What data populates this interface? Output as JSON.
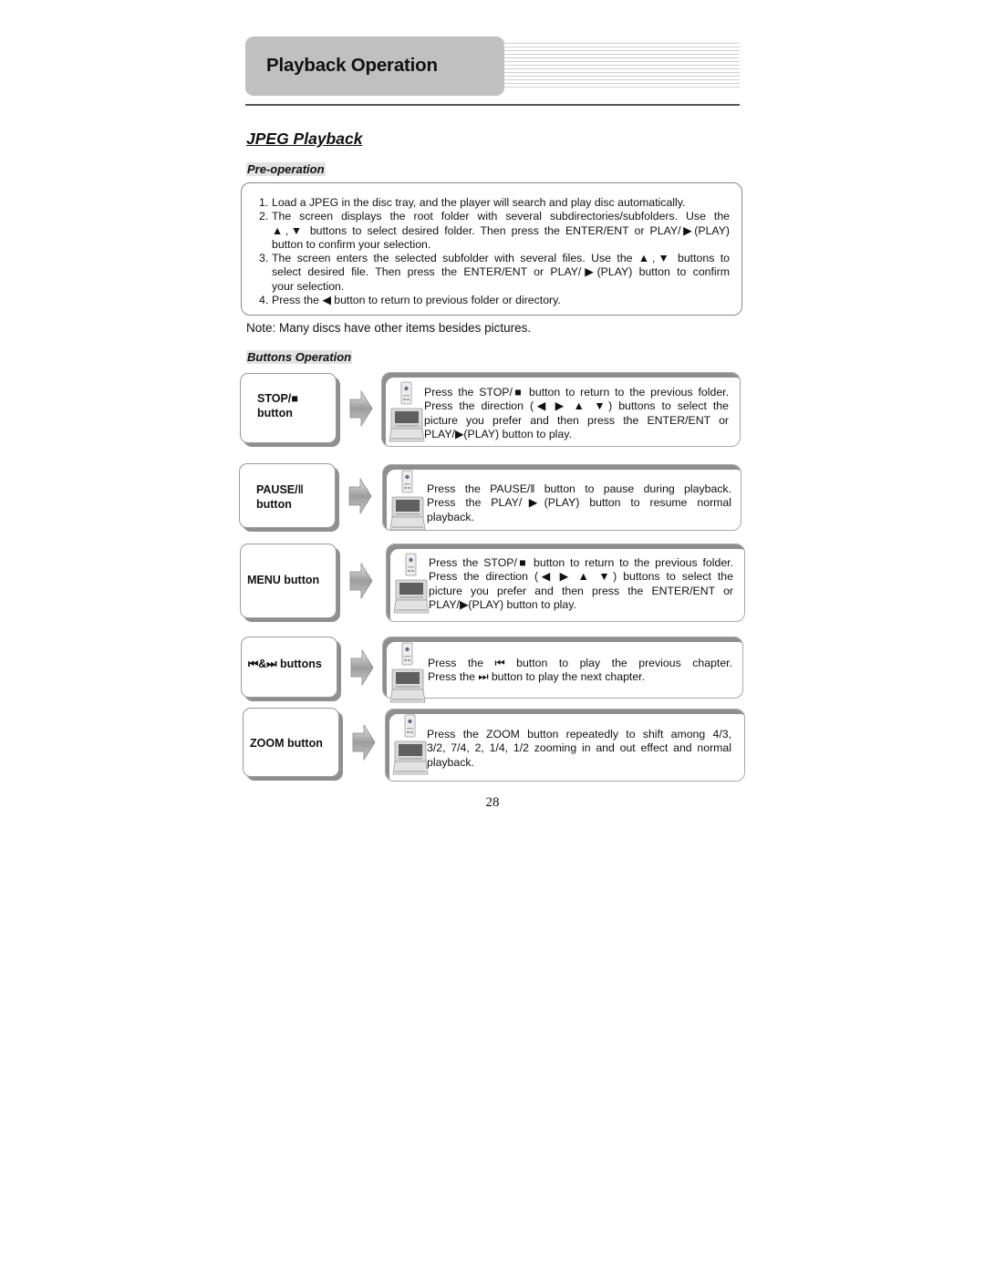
{
  "header": {
    "title": "Playback Operation"
  },
  "section": {
    "title": "JPEG Playback"
  },
  "pre_operation": {
    "title": "Pre-operation",
    "items": [
      {
        "num": "1.",
        "lines": [
          "Load a JPEG in the disc tray, and the player will search and play disc automatically."
        ]
      },
      {
        "num": "2.",
        "lines": [
          "The screen displays the root folder with several subdirectories/subfolders. Use the",
          "▲,▼ buttons to select desired folder. Then press the ENTER/ENT or PLAY/▶(PLAY)",
          "button to confirm your selection."
        ]
      },
      {
        "num": "3.",
        "lines": [
          "The screen enters the selected subfolder with several files. Use the ▲,▼ buttons to",
          "select desired file. Then press the ENTER/ENT or PLAY/▶(PLAY) button to confirm",
          "your selection."
        ]
      },
      {
        "num": "4.",
        "lines": [
          "Press the ◀ button to return to previous folder or directory."
        ]
      }
    ]
  },
  "note": "Note: Many discs have other items besides pictures.",
  "buttons_operation": {
    "title": "Buttons Operation",
    "rows": [
      {
        "label_line1": "STOP/■",
        "label_line2": "button",
        "icon": "device-remote-icon",
        "lines": [
          "Press the STOP/■ button to return to the previous folder.",
          "Press the direction (◀ ▶ ▲ ▼) buttons to select the",
          "picture you prefer and then press the ENTER/ENT or",
          "PLAY/▶(PLAY) button to play."
        ]
      },
      {
        "label_line1": "PAUSE/‖",
        "label_line2": "button",
        "icon": "device-remote-icon",
        "lines": [
          "Press the PAUSE/‖ button to pause during playback.",
          "Press the PLAY/▶(PLAY) button to resume normal",
          "playback."
        ]
      },
      {
        "label_line1": "MENU button",
        "label_line2": "",
        "icon": "device-remote-icon",
        "lines": [
          "Press the STOP/■ button to return to the previous folder.",
          "Press the direction (◀ ▶ ▲ ▼) buttons to select the",
          "picture you prefer and then press the ENTER/ENT or",
          "PLAY/▶(PLAY) button to play."
        ]
      },
      {
        "label_line1": "⏮&⏭ buttons",
        "label_line2": "",
        "icon": "device-remote-icon",
        "lines": [
          "Press the ⏮ button to play the previous chapter.",
          "Press the ⏭ button to play the next chapter."
        ]
      },
      {
        "label_line1": "ZOOM button",
        "label_line2": "",
        "icon": "device-remote-icon",
        "lines": [
          "Press the ZOOM button repeatedly to shift among 4/3,",
          "3/2, 7/4, 2, 1/4, 1/2 zooming in and out effect and normal",
          "playback."
        ]
      }
    ]
  },
  "page_number": "28"
}
